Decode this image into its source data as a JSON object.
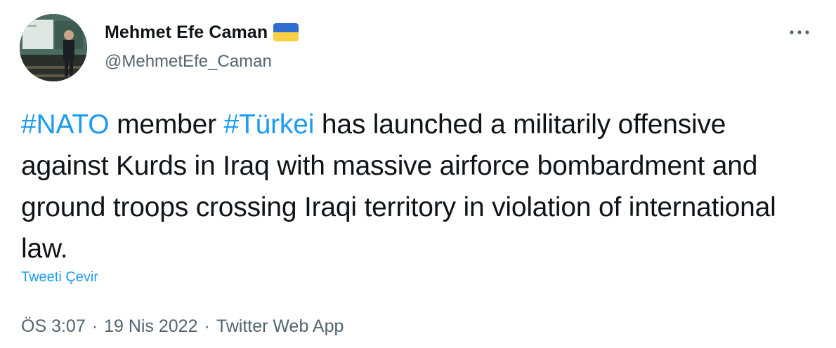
{
  "author": {
    "display_name": "Mehmet Efe Caman",
    "handle": "@MehmetEfe_Caman",
    "flag_icon": "ukraine-flag-icon",
    "flag_colors": [
      "#2f6fd1",
      "#f7d046"
    ]
  },
  "tweet": {
    "hashtag_1": "#NATO",
    "text_1": " member ",
    "hashtag_2": "#Türkei",
    "text_2": " has launched a militarily offensive against Kurds in Iraq with massive airforce bombardment and ground troops crossing Iraqi territory in violation of international law."
  },
  "translate_label": "Tweeti Çevir",
  "meta": {
    "time": "ÖS 3:07",
    "separator_1": "·",
    "date": "19 Nis 2022",
    "separator_2": "·",
    "source": "Twitter Web App"
  },
  "colors": {
    "link": "#1d9bf0",
    "secondary_text": "#536471",
    "primary_text": "#0f1419"
  }
}
